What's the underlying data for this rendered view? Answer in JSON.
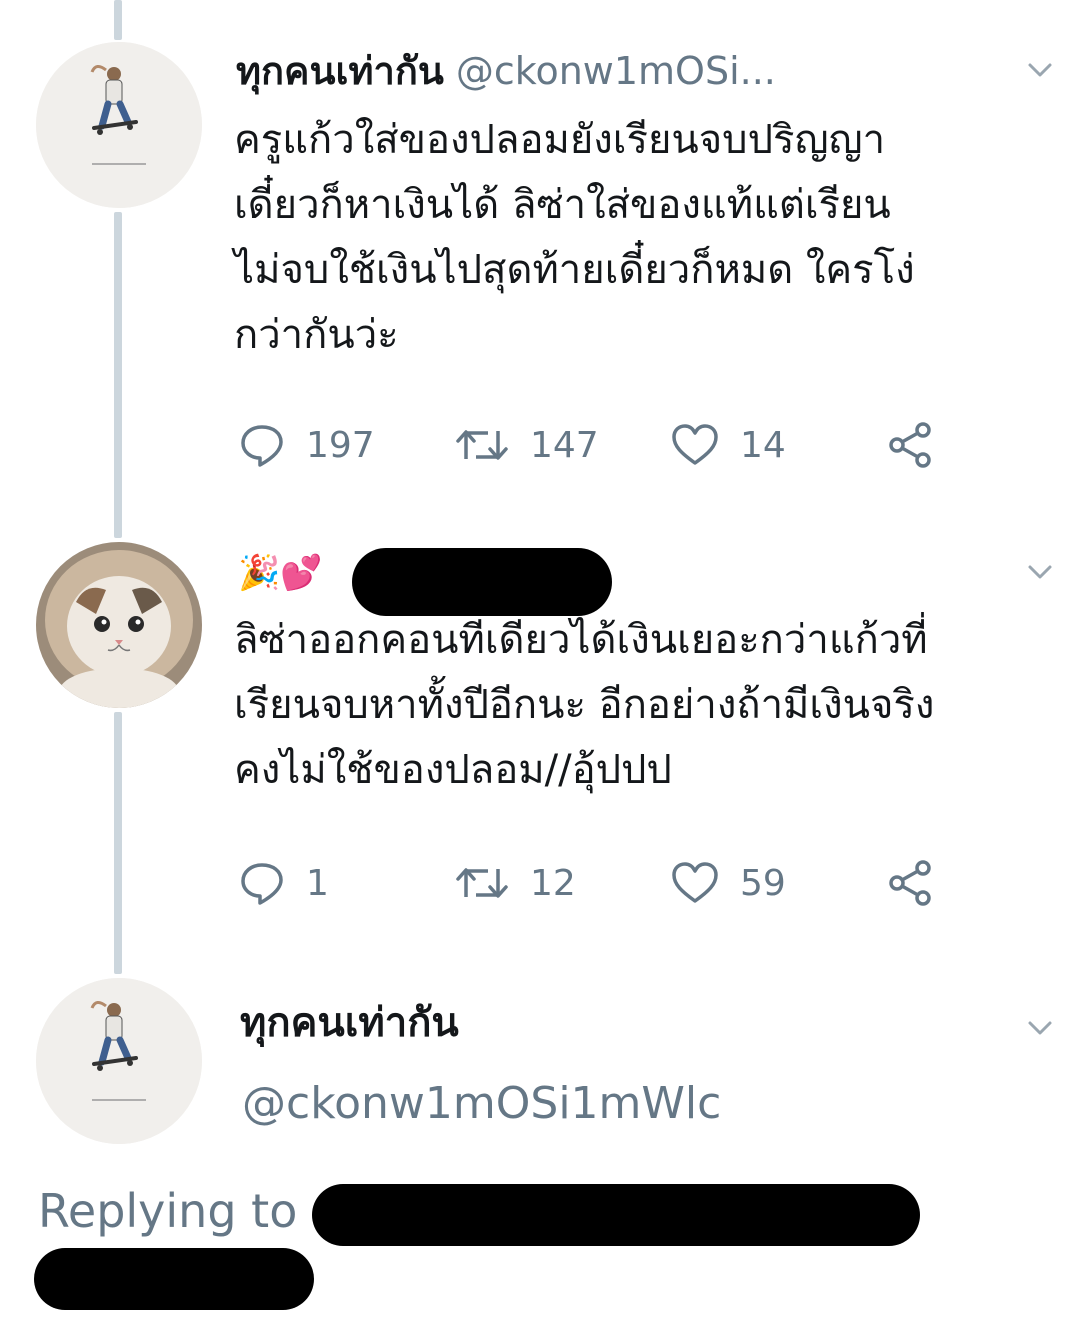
{
  "tweet1": {
    "display_name": "ทุกคนเท่ากัน",
    "handle": "@ckonw1mOSi...",
    "text": "ครูแก้วใส่ของปลอมยังเรียนจบปริญญา\nเดี๋ยวก็หาเงินได้ ลิซ่าใส่ของแท้แต่เรียน\nไม่จบใช้เงินไปสุดท้ายเดี๋ยวก็หมด ใครโง่\nกว่ากันว่ะ",
    "replies": "197",
    "retweets": "147",
    "likes": "14",
    "avatar_icon": "skateboarder-avatar-icon"
  },
  "tweet2": {
    "emoji_prefix": "🎉💕",
    "text": "ลิซ่าออกคอนทีเดียวได้เงินเยอะกว่าแก้วที่\nเรียนจบหาทั้งปีอีกนะ อีกอย่างถ้ามีเงินจริง\nคงไม่ใช้ของปลอม//อุ้ปปป",
    "replies": "1",
    "retweets": "12",
    "likes": "59",
    "avatar_icon": "cat-avatar-icon"
  },
  "tweet3": {
    "display_name": "ทุกคนเท่ากัน",
    "handle": "@ckonw1mOSi1mWlc",
    "replying_to": "Replying to @",
    "avatar_icon": "skateboarder-avatar-icon"
  },
  "colors": {
    "text": "#14171a",
    "secondary": "#657786",
    "thread_line": "#ccd6dd"
  }
}
